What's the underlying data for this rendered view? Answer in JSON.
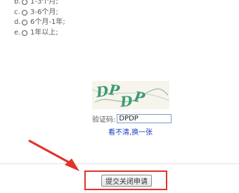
{
  "options": [
    {
      "letter": "b.",
      "label": "1-3个月;"
    },
    {
      "letter": "c.",
      "label": "3-6个月;"
    },
    {
      "letter": "d.",
      "label": "6个月-1年;"
    },
    {
      "letter": "e.",
      "label": "1年以上;"
    }
  ],
  "captcha": {
    "text": "DPDP"
  },
  "verify": {
    "label": "验证码:",
    "value": "DPDP"
  },
  "refresh_link": "看不清,换一张",
  "submit_label": "提交关闭申请",
  "colors": {
    "highlight": "#e0332a",
    "link": "#1b3fbf",
    "captcha_text": "#3f9a78"
  }
}
